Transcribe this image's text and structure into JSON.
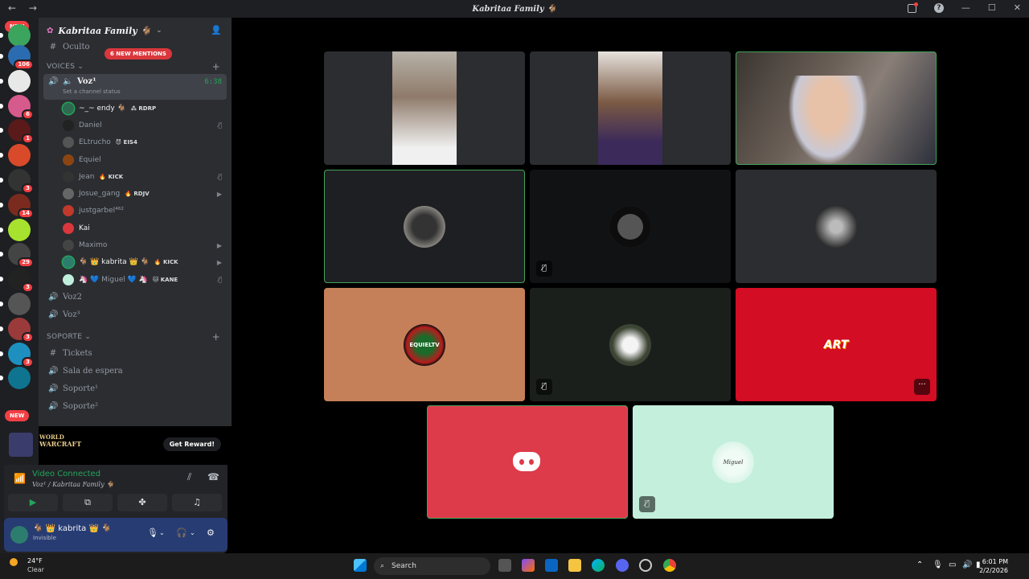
{
  "window": {
    "title": "Kabritaa Family 🐐",
    "back": "←",
    "forward": "→"
  },
  "rail": {
    "new_top": "NEW",
    "new_bottom": "NEW",
    "servers": [
      {
        "badge": "",
        "color": "#3ba55d"
      },
      {
        "badge": "106",
        "color": "#2b6cb0"
      },
      {
        "badge": "",
        "color": "#e8e8e8"
      },
      {
        "badge": "6",
        "color": "#d65a8b"
      },
      {
        "badge": "1",
        "color": "#5a1a1a"
      },
      {
        "badge": "",
        "color": "#d94a2a"
      },
      {
        "badge": "3",
        "color": "#333333"
      },
      {
        "badge": "14",
        "color": "#7a2b1e"
      },
      {
        "badge": "",
        "color": "#a6e22e"
      },
      {
        "badge": "29",
        "color": "#444444"
      },
      {
        "badge": "3",
        "color": "#222222"
      },
      {
        "badge": "",
        "color": "#555555"
      },
      {
        "badge": "3",
        "color": "#9a3a3a"
      },
      {
        "badge": "3",
        "color": "#1e90c0"
      },
      {
        "badge": "",
        "color": "#0e7490"
      }
    ]
  },
  "guild": {
    "name": "Kabritaa Family 🐐",
    "mentions": "6 NEW MENTIONS",
    "top_channel": "Oculto"
  },
  "categories": {
    "voices": "VOICES",
    "soporte": "SOPORTE"
  },
  "active_channel": {
    "name": "Voz¹",
    "status": "Set a channel status",
    "timer": "6:38"
  },
  "voice_users": [
    {
      "name": "~_~ endy 🐐",
      "tag": "⁂ RDRP",
      "bright": true,
      "speaking": true,
      "right": "",
      "color": "#2d6a4f"
    },
    {
      "name": "Daniel",
      "tag": "",
      "bright": false,
      "speaking": false,
      "right": "🎙̸",
      "color": "#222"
    },
    {
      "name": "ELtrucho",
      "tag": "😈 EIS4",
      "bright": false,
      "speaking": false,
      "right": "",
      "color": "#555"
    },
    {
      "name": "Equiel",
      "tag": "",
      "bright": false,
      "speaking": false,
      "right": "",
      "color": "#8b4513"
    },
    {
      "name": "Jean",
      "tag": "🔥 KICK",
      "bright": false,
      "speaking": false,
      "right": "🎙̸",
      "color": "#333"
    },
    {
      "name": "Josue_gang",
      "tag": "🔥 RDJV",
      "bright": false,
      "speaking": false,
      "right": "▶",
      "color": "#666"
    },
    {
      "name": "justgarbel⁴⁶²",
      "tag": "",
      "bright": false,
      "speaking": false,
      "right": "",
      "color": "#c0392b"
    },
    {
      "name": "Kai",
      "tag": "",
      "bright": true,
      "speaking": false,
      "right": "",
      "color": "#da373c"
    },
    {
      "name": "Maximo",
      "tag": "",
      "bright": false,
      "speaking": false,
      "right": "▶",
      "color": "#444"
    },
    {
      "name": "🐐 👑 kabrita 👑 🐐",
      "tag": "🔥 KICK",
      "bright": true,
      "speaking": true,
      "right": "▶",
      "color": "#2d7d6e"
    },
    {
      "name": "🦄 💙 Miguel 💙 🦄",
      "tag": "🐱 KANE",
      "bright": false,
      "speaking": false,
      "right": "🎙̸",
      "color": "#bfeedd"
    }
  ],
  "channels_after": [
    {
      "icon": "🔊",
      "name": "Voz2"
    },
    {
      "icon": "🔊",
      "name": "Voz³"
    }
  ],
  "soporte_channels": [
    {
      "icon": "#",
      "name": "Tickets"
    },
    {
      "icon": "🔊",
      "name": "Sala de espera"
    },
    {
      "icon": "🔊",
      "name": "Soporte¹"
    },
    {
      "icon": "🔊",
      "name": "Soporte²"
    }
  ],
  "promo": {
    "line1": "WORLD",
    "line2": "WARCRAFT",
    "button": "Get Reward!"
  },
  "voice_panel": {
    "status": "Video Connected",
    "location": "Voz¹ / Kabritaa Family 🐐"
  },
  "user": {
    "name": "🐐 👑 kabrita 👑 🐐",
    "status": "Invisible"
  },
  "tiles": {
    "discord_logo": "discord-logo",
    "miguel_label": "Miguel",
    "art_label": "ART",
    "equiel_label": "EQUIELTV",
    "more": "···"
  },
  "taskbar": {
    "temp": "24°F",
    "weather": "Clear",
    "search": "Search",
    "time": "6:01 PM",
    "date": "2/2/2026"
  }
}
